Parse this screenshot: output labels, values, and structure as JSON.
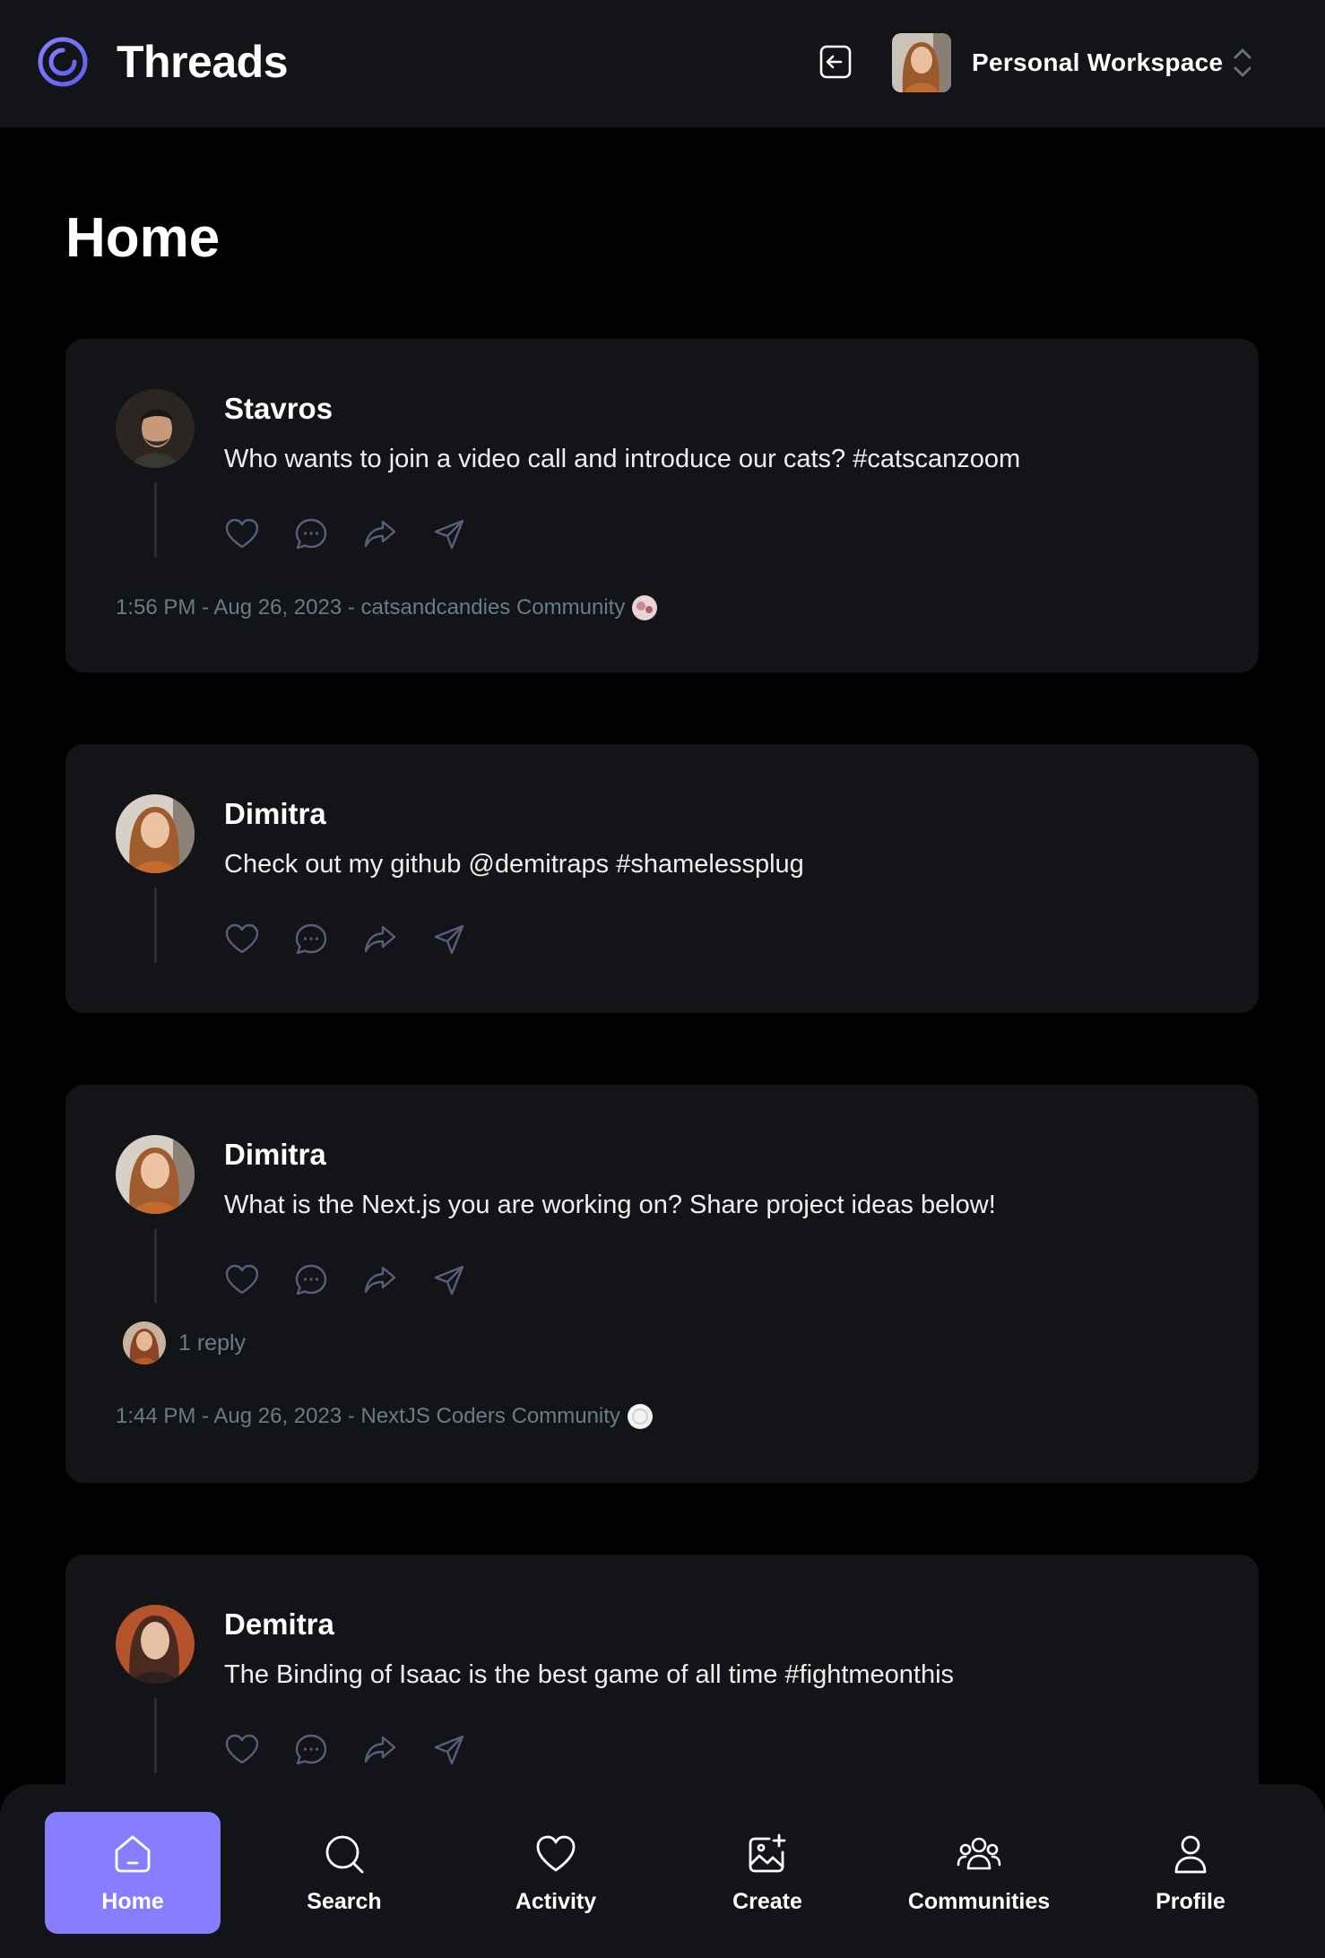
{
  "header": {
    "app_title": "Threads",
    "logo_icon": "threads-logo-icon",
    "logout_icon": "logout-icon",
    "workspace_name": "Personal Workspace",
    "workspace_switch_icon": "chevron-up-down-icon",
    "accent": "#877eff"
  },
  "page": {
    "title": "Home"
  },
  "threads": [
    {
      "author": "Stavros",
      "content": "Who wants to join a video call and introduce our cats? #catscanzoom",
      "meta": "1:56 PM - Aug 26, 2023 - catsandcandies Community",
      "replies": ""
    },
    {
      "author": "Dimitra",
      "content": "Check out my github @demitraps #shamelessplug",
      "meta": "",
      "replies": ""
    },
    {
      "author": "Dimitra",
      "content": "What is the Next.js you are working on? Share project ideas below!",
      "meta": "1:44 PM - Aug 26, 2023 - NextJS Coders Community",
      "replies": "1 reply"
    },
    {
      "author": "Demitra",
      "content": "The Binding of Isaac is the best game of all time #fightmeonthis",
      "meta": "",
      "replies": ""
    }
  ],
  "action_icons": [
    "heart-icon",
    "comment-icon",
    "repost-icon",
    "share-icon"
  ],
  "nav": [
    {
      "label": "Home",
      "icon": "home-icon",
      "active": true
    },
    {
      "label": "Search",
      "icon": "search-icon",
      "active": false
    },
    {
      "label": "Activity",
      "icon": "heart-icon",
      "active": false
    },
    {
      "label": "Create",
      "icon": "create-image-icon",
      "active": false
    },
    {
      "label": "Communities",
      "icon": "communities-icon",
      "active": false
    },
    {
      "label": "Profile",
      "icon": "profile-icon",
      "active": false
    }
  ],
  "colors": {
    "background": "#000000",
    "surface": "#121417",
    "muted_text": "#697c89",
    "icon_stroke": "#5c5c7b",
    "active_nav": "#877eff"
  }
}
